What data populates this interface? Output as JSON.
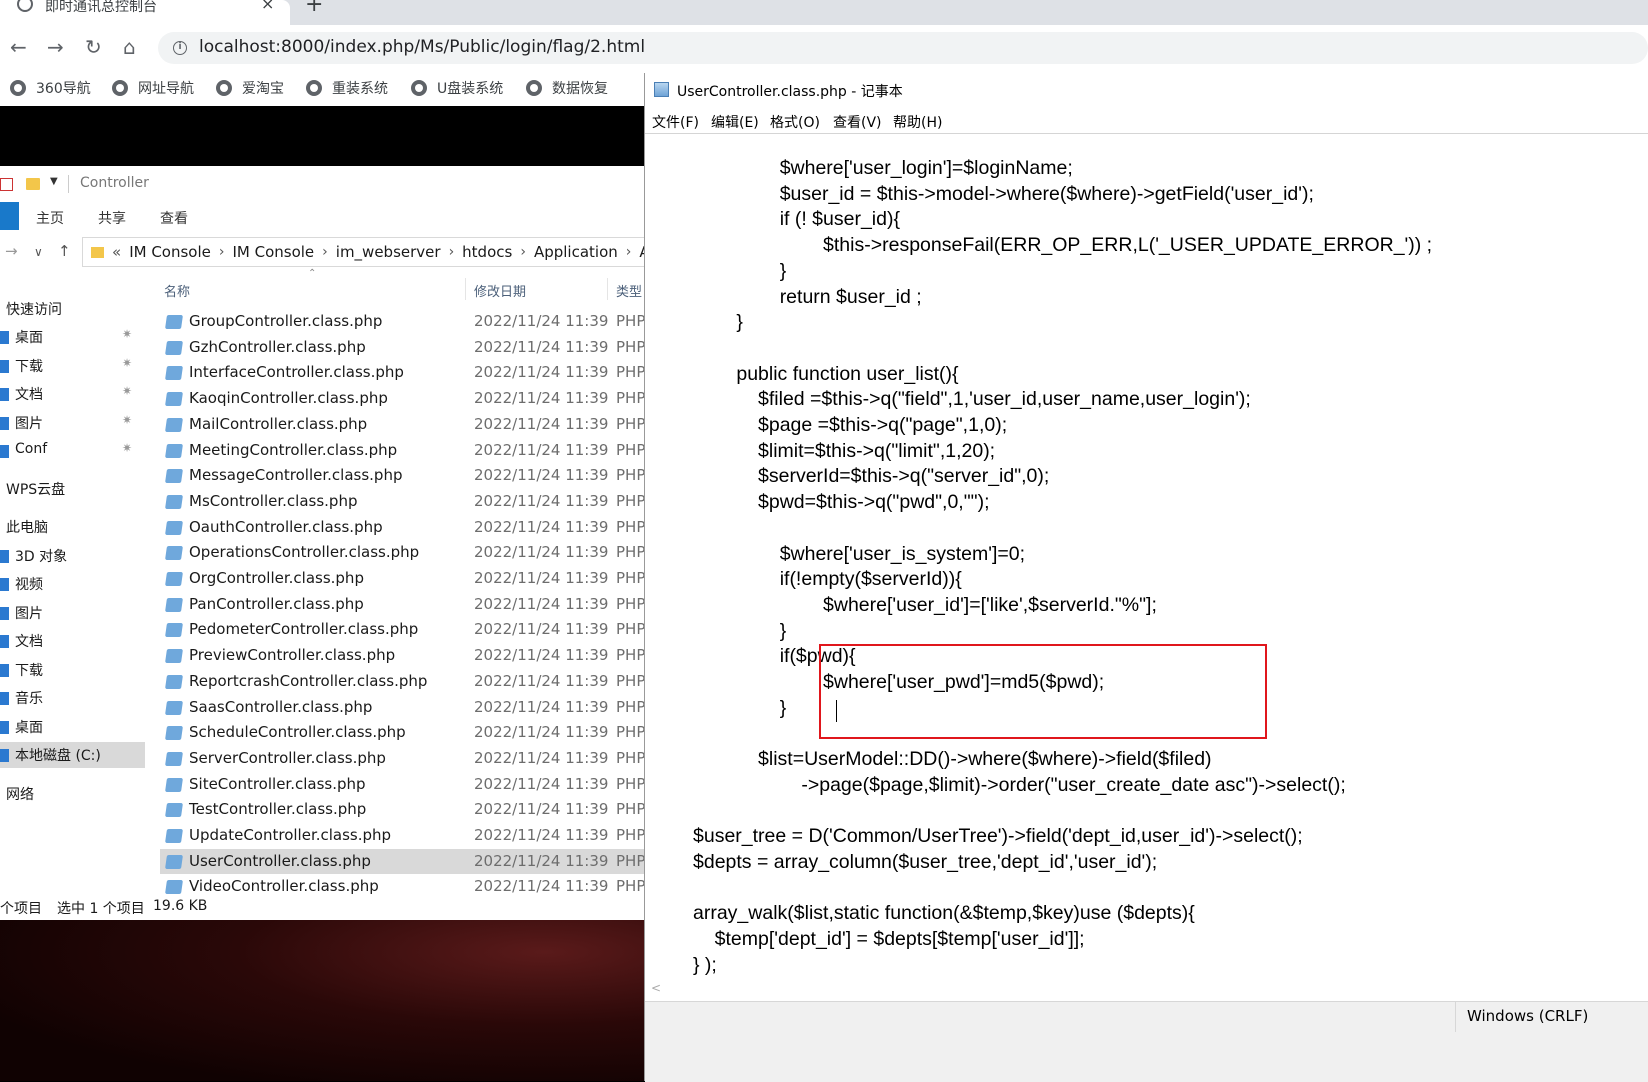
{
  "browser": {
    "tab_title": "即时通讯总控制台",
    "close_glyph": "×",
    "new_tab_glyph": "+",
    "url": "localhost:8000/index.php/Ms/Public/login/flag/2.html",
    "bookmarks": [
      "360导航",
      "网址导航",
      "爱淘宝",
      "重装系统",
      "U盘装系统",
      "数据恢复"
    ]
  },
  "explorer": {
    "title": "Controller",
    "ribbon_tabs": [
      "主页",
      "共享",
      "查看"
    ],
    "breadcrumb": [
      "IM Console",
      "IM Console",
      "im_webserver",
      "htdocs",
      "Application",
      "A"
    ],
    "nav": [
      {
        "label": "快速访问",
        "header": true
      },
      {
        "label": "桌面",
        "pinned": true
      },
      {
        "label": "下载",
        "pinned": true
      },
      {
        "label": "文档",
        "pinned": true
      },
      {
        "label": "图片",
        "pinned": true
      },
      {
        "label": "Conf",
        "pinned": true
      },
      {
        "label": "WPS云盘",
        "header": true
      },
      {
        "label": "此电脑",
        "header": true
      },
      {
        "label": "3D 对象"
      },
      {
        "label": "视频"
      },
      {
        "label": "图片"
      },
      {
        "label": "文档"
      },
      {
        "label": "下载"
      },
      {
        "label": "音乐"
      },
      {
        "label": "桌面"
      },
      {
        "label": "本地磁盘 (C:)",
        "selected": true
      },
      {
        "label": "网络",
        "header": true
      }
    ],
    "columns": {
      "name": "名称",
      "date": "修改日期",
      "type": "类型"
    },
    "files": [
      {
        "name": "GroupController.class.php",
        "date": "2022/11/24 11:39",
        "type": "PHP"
      },
      {
        "name": "GzhController.class.php",
        "date": "2022/11/24 11:39",
        "type": "PHP"
      },
      {
        "name": "InterfaceController.class.php",
        "date": "2022/11/24 11:39",
        "type": "PHP"
      },
      {
        "name": "KaoqinController.class.php",
        "date": "2022/11/24 11:39",
        "type": "PHP"
      },
      {
        "name": "MailController.class.php",
        "date": "2022/11/24 11:39",
        "type": "PHP"
      },
      {
        "name": "MeetingController.class.php",
        "date": "2022/11/24 11:39",
        "type": "PHP"
      },
      {
        "name": "MessageController.class.php",
        "date": "2022/11/24 11:39",
        "type": "PHP"
      },
      {
        "name": "MsController.class.php",
        "date": "2022/11/24 11:39",
        "type": "PHP"
      },
      {
        "name": "OauthController.class.php",
        "date": "2022/11/24 11:39",
        "type": "PHP"
      },
      {
        "name": "OperationsController.class.php",
        "date": "2022/11/24 11:39",
        "type": "PHP"
      },
      {
        "name": "OrgController.class.php",
        "date": "2022/11/24 11:39",
        "type": "PHP"
      },
      {
        "name": "PanController.class.php",
        "date": "2022/11/24 11:39",
        "type": "PHP"
      },
      {
        "name": "PedometerController.class.php",
        "date": "2022/11/24 11:39",
        "type": "PHP"
      },
      {
        "name": "PreviewController.class.php",
        "date": "2022/11/24 11:39",
        "type": "PHP"
      },
      {
        "name": "ReportcrashController.class.php",
        "date": "2022/11/24 11:39",
        "type": "PHP"
      },
      {
        "name": "SaasController.class.php",
        "date": "2022/11/24 11:39",
        "type": "PHP"
      },
      {
        "name": "ScheduleController.class.php",
        "date": "2022/11/24 11:39",
        "type": "PHP"
      },
      {
        "name": "ServerController.class.php",
        "date": "2022/11/24 11:39",
        "type": "PHP"
      },
      {
        "name": "SiteController.class.php",
        "date": "2022/11/24 11:39",
        "type": "PHP"
      },
      {
        "name": "TestController.class.php",
        "date": "2022/11/24 11:39",
        "type": "PHP"
      },
      {
        "name": "UpdateController.class.php",
        "date": "2022/11/24 11:39",
        "type": "PHP"
      },
      {
        "name": "UserController.class.php",
        "date": "2022/11/24 11:39",
        "type": "PHP",
        "selected": true
      },
      {
        "name": "VideoController.class.php",
        "date": "2022/11/24 11:39",
        "type": "PHP"
      }
    ],
    "status": {
      "count": "个项目",
      "selection": "选中 1 个项目",
      "size": "19.6 KB"
    }
  },
  "notepad": {
    "title": "UserController.class.php - 记事本",
    "menus": [
      "文件(F)",
      "编辑(E)",
      "格式(O)",
      "查看(V)",
      "帮助(H)"
    ],
    "code": "\t\t$where['user_login']=$loginName;\n\t\t$user_id = $this->model->where($where)->getField('user_id');\n\t\tif (! $user_id){\n\t\t\t$this->responseFail(ERR_OP_ERR,L('_USER_UPDATE_ERROR_')) ;\n\t\t}\n\t\treturn $user_id ;\n\t}\n\n\tpublic function user_list(){\n\t    $filed =$this->q(\"field\",1,'user_id,user_name,user_login');\n\t    $page =$this->q(\"page\",1,0);\n\t    $limit=$this->q(\"limit\",1,20);\n\t    $serverId=$this->q(\"server_id\",0);\n\t    $pwd=$this->q(\"pwd\",0,\"\");\n\n\t\t$where['user_is_system']=0;\n\t\tif(!empty($serverId)){\n\t\t\t$where['user_id']=['like',$serverId.\"%\"];\n\t\t}\n\t\tif($pwd){\n\t\t\t$where['user_pwd']=md5($pwd);\n\t\t}\n\n\t    $list=UserModel::DD()->where($where)->field($filed)\n\t\t    ->page($page,$limit)->order(\"user_create_date asc\")->select();\n\n$user_tree = D('Common/UserTree')->field('dept_id,user_id')->select();\n$depts = array_column($user_tree,'dept_id','user_id');\n\narray_walk($list,static function(&$temp,$key)use ($depts){\n    $temp['dept_id'] = $depts[$temp['user_id']];\n} );",
    "eol": "Windows (CRLF)"
  },
  "colors": {
    "highlight_border": "#e0161c",
    "selection_bg": "#d9d9d9",
    "accent": "#1979ca"
  }
}
